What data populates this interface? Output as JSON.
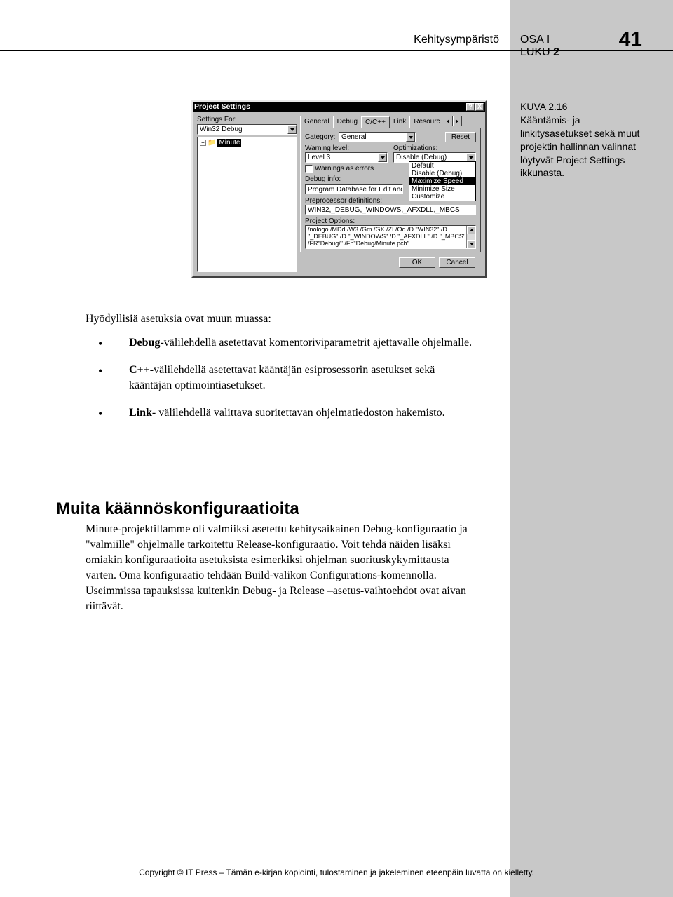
{
  "header": {
    "subtitle": "Kehitysympäristö",
    "osa_label": "OSA",
    "osa_num": "I",
    "luku_label": "LUKU",
    "luku_num": "2",
    "page": "41"
  },
  "caption": {
    "label": "KUVA 2.16",
    "text": "Kääntämis- ja linkitysasetukset sekä muut projektin hallinnan valinnat löytyvät Project Settings –ikkunasta."
  },
  "dialog": {
    "title": "Project Settings",
    "help_btn": "?",
    "close_btn": "X",
    "settings_for_label": "Settings For:",
    "settings_for_value": "Win32 Debug",
    "tree_item": "Minute",
    "tabs": [
      "General",
      "Debug",
      "C/C++",
      "Link",
      "Resourc"
    ],
    "category_label": "Category:",
    "category_value": "General",
    "reset_btn": "Reset",
    "warning_label": "Warning level:",
    "warning_value": "Level 3",
    "optim_label": "Optimizations:",
    "optim_value": "Disable (Debug)",
    "optim_options": [
      "Default",
      "Disable (Debug)",
      "Maximize Speed",
      "Minimize Size",
      "Customize"
    ],
    "warnings_errors": "Warnings as errors",
    "debuginfo_label": "Debug info:",
    "debuginfo_value": "Program Database for Edit and",
    "preproc_label": "Preprocessor definitions:",
    "preproc_value": "WIN32,_DEBUG,_WINDOWS,_AFXDLL,_MBCS",
    "projopt_label": "Project Options:",
    "projopt_value": "/nologo /MDd /W3 /Gm /GX /ZI /Od /D \"WIN32\" /D \"_DEBUG\" /D \"_WINDOWS\" /D \"_AFXDLL\" /D \"_MBCS\" /FR\"Debug/\" /Fp\"Debug/Minute.pch\"",
    "ok_btn": "OK",
    "cancel_btn": "Cancel"
  },
  "body": {
    "intro": "Hyödyllisiä asetuksia ovat muun muassa:",
    "bullets": [
      "<b>Debug</b>-välilehdellä asetettavat komentoriviparametrit ajettavalle ohjelmalle.",
      "<b>C++</b>-välilehdellä asetettavat kääntäjän esiprosessorin asetukset sekä kääntäjän optimointiasetukset.",
      "<b>Link</b>- välilehdellä valittava suoritettavan ohjelmatiedoston hakemisto."
    ],
    "section_heading": "Muita käännöskonfiguraatioita",
    "section_body": "Minute-projektillamme oli valmiiksi asetettu kehitysaikainen Debug-konfiguraatio ja \"valmiille\" ohjelmalle tarkoitettu Release-konfiguraatio. Voit tehdä näiden lisäksi omiakin konfiguraatioita asetuksista esimerkiksi ohjelman suorituskykymittausta varten. Oma konfiguraatio tehdään Build-valikon Configurations-komennolla. Useimmissa tapauksissa kuitenkin Debug- ja Release –asetus-vaihtoehdot ovat aivan riittävät."
  },
  "footer": "Copyright © IT Press – Tämän e-kirjan kopiointi, tulostaminen ja jakeleminen eteenpäin luvatta on kielletty."
}
